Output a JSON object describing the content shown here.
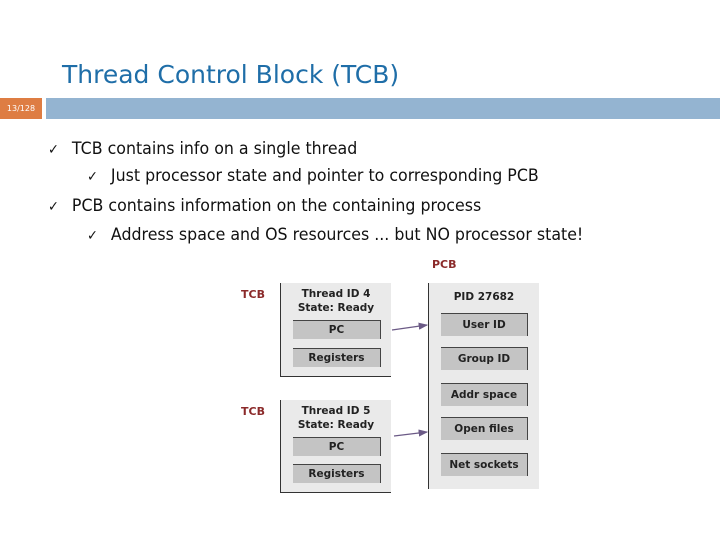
{
  "slide": {
    "title": "Thread Control Block (TCB)",
    "slide_number": "13/128",
    "colors": {
      "title": "#1f6ea8",
      "number_box": "#de7d43",
      "header_bar": "#94b4d1",
      "diagram_label": "#8b2a2a",
      "arrow": "#6b5a86"
    }
  },
  "bullets": [
    {
      "level": 1,
      "icon": "checkmark-icon",
      "mark": "✓",
      "text": "TCB contains info on a single thread"
    },
    {
      "level": 2,
      "icon": "checkmark-icon",
      "mark": "✓",
      "text": "Just processor state and pointer to corresponding PCB"
    },
    {
      "level": 1,
      "icon": "checkmark-icon",
      "mark": "✓",
      "text": "PCB contains information on the containing process"
    },
    {
      "level": 2,
      "icon": "checkmark-icon",
      "mark": "✓",
      "text": "Address space and OS resources ... but NO processor state!"
    }
  ],
  "diagram": {
    "tcbs": [
      {
        "label": "TCB",
        "header_line1": "Thread ID 4",
        "header_line2": "State: Ready",
        "fields": [
          "PC",
          "Registers"
        ]
      },
      {
        "label": "TCB",
        "header_line1": "Thread ID 5",
        "header_line2": "State: Ready",
        "fields": [
          "PC",
          "Registers"
        ]
      }
    ],
    "pcb": {
      "label": "PCB",
      "header": "PID 27682",
      "fields": [
        "User ID",
        "Group ID",
        "Addr space",
        "Open files",
        "Net sockets"
      ]
    }
  }
}
